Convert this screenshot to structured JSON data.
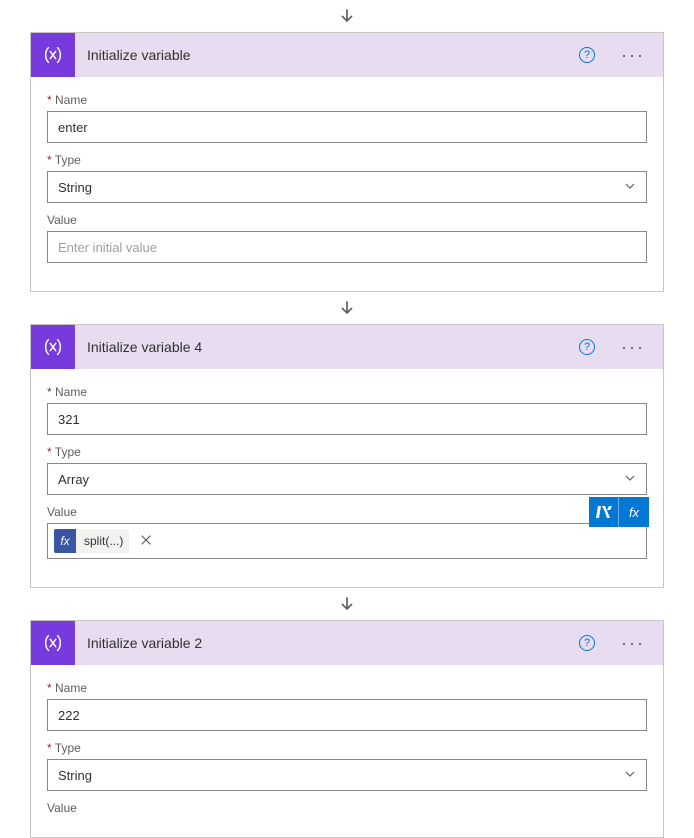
{
  "cards": [
    {
      "title": "Initialize variable",
      "fields": {
        "name_label": "Name",
        "name_value": "enter",
        "type_label": "Type",
        "type_value": "String",
        "value_label": "Value",
        "value_placeholder": "Enter initial value"
      }
    },
    {
      "title": "Initialize variable 4",
      "fields": {
        "name_label": "Name",
        "name_value": "321",
        "type_label": "Type",
        "type_value": "Array",
        "value_label": "Value",
        "token_text": "split(...)"
      }
    },
    {
      "title": "Initialize variable 2",
      "fields": {
        "name_label": "Name",
        "name_value": "222",
        "type_label": "Type",
        "type_value": "String",
        "value_label": "Value"
      }
    }
  ],
  "fx_label": "fx"
}
